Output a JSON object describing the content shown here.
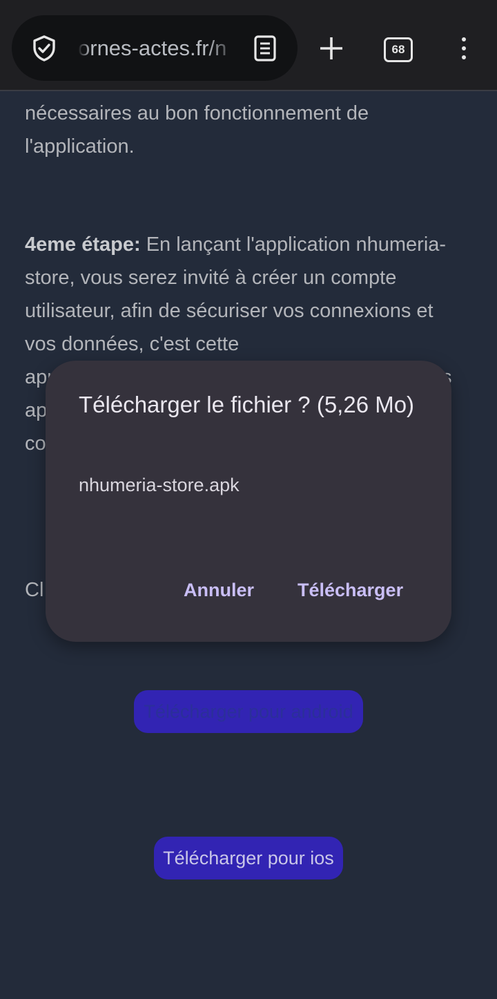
{
  "browser": {
    "url": "ornes-actes.fr/n",
    "tab_count": "68"
  },
  "content": {
    "para1": "nécessaires au bon fonctionnement de l'application.",
    "step4_label": "4eme étape:",
    "step4_text": " En lançant l'application nhumeria-store, vous serez invité à créer un compte utilisateur, afin de sécuriser vos connexions et vos données, c'est cette",
    "partial_app": "apr",
    "partial_ap": "ap",
    "partial_co": "co",
    "partial_right": "s",
    "partial_cl": "Cl"
  },
  "buttons": {
    "android": "Télécharger pour android",
    "ios": "Télécharger pour ios"
  },
  "dialog": {
    "title": "Télécharger le fichier ? (5,26 Mo)",
    "filename": "nhumeria-store.apk",
    "cancel": "Annuler",
    "confirm": "Télécharger"
  },
  "colors": {
    "page_bg": "#232b3a",
    "button_bg": "#3224b3",
    "dialog_bg": "#35323c",
    "dialog_action": "#c9bef6"
  }
}
